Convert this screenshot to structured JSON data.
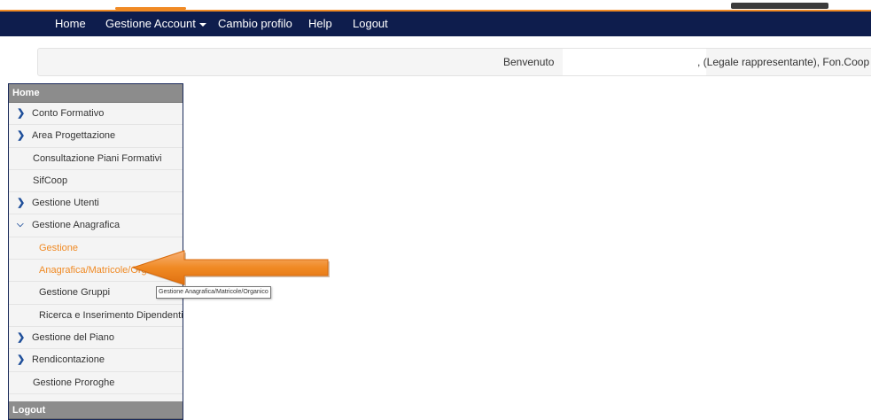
{
  "navbar": {
    "home": "Home",
    "gestione_account": "Gestione Account",
    "cambio_profilo": "Cambio profilo",
    "help": "Help",
    "logout": "Logout"
  },
  "welcome": {
    "label": "Benvenuto",
    "role": ", (Legale rappresentante), Fon.Coop"
  },
  "sidebar": {
    "header": "Home",
    "items": [
      {
        "label": "Conto Formativo"
      },
      {
        "label": "Area Progettazione"
      },
      {
        "label": "Consultazione Piani Formativi"
      },
      {
        "label": "SifCoop"
      },
      {
        "label": "Gestione Utenti"
      },
      {
        "label": "Gestione Anagrafica"
      },
      {
        "label": "Gestione"
      },
      {
        "label": "Anagrafica/Matricole/Organico"
      },
      {
        "label": "Gestione Gruppi"
      },
      {
        "label": "Ricerca e Inserimento Dipendenti"
      },
      {
        "label": "Gestione del Piano"
      },
      {
        "label": "Rendicontazione"
      },
      {
        "label": "Gestione Proroghe"
      }
    ],
    "footer": "Logout"
  },
  "tooltip": {
    "text": "Gestione Anagrafica/Matricole/Organico"
  },
  "colors": {
    "navbar_bg": "#0e1d4d",
    "accent": "#f08a24",
    "chevron": "#1f4f9a",
    "sidebar_header": "#8c8c8c"
  },
  "icons": {
    "chevron_right": "chevron-right-icon",
    "chevron_down": "chevron-down-icon",
    "caret_down": "caret-down-icon",
    "annotation_arrow": "arrow-left-icon"
  }
}
